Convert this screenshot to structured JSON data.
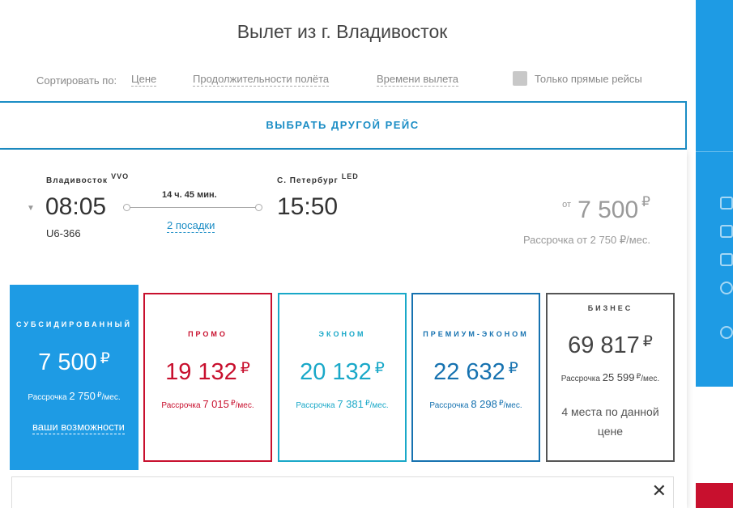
{
  "title": "Вылет из г. Владивосток",
  "sort": {
    "label": "Сортировать по:",
    "options": [
      "Цене",
      "Продолжительности полёта",
      "Времени вылета"
    ],
    "direct_only": "Только прямые рейсы",
    "direct_checked": false
  },
  "choose_other": "ВЫБРАТЬ ДРУГОЙ РЕЙС",
  "flight": {
    "from_city": "Владивосток",
    "from_code": "VVO",
    "to_city": "С. Петербург",
    "to_code": "LED",
    "depart_time": "08:05",
    "arrive_time": "15:50",
    "duration": "14 ч. 45 мин.",
    "stops": "2 посадки",
    "flight_number": "U6-366",
    "price_prefix": "от",
    "price": "7 500",
    "currency": "₽",
    "installment": "Рассрочка от 2 750 ₽/мес."
  },
  "fares": [
    {
      "name": "СУБСИДИРОВАННЫЙ",
      "price": "7 500",
      "inst_prefix": "Рассрочка",
      "inst_value": "2 750",
      "inst_suffix": "/мес.",
      "link": "ваши возможности"
    },
    {
      "name": "ПРОМО",
      "price": "19 132",
      "inst_prefix": "Рассрочка",
      "inst_value": "7 015",
      "inst_suffix": "/мес."
    },
    {
      "name": "ЭКОНОМ",
      "price": "20 132",
      "inst_prefix": "Рассрочка",
      "inst_value": "7 381",
      "inst_suffix": "/мес."
    },
    {
      "name": "ПРЕМИУМ-ЭКОНОМ",
      "price": "22 632",
      "inst_prefix": "Рассрочка",
      "inst_value": "8 298",
      "inst_suffix": "/мес."
    },
    {
      "name": "БИЗНЕС",
      "price": "69 817",
      "inst_prefix": "Рассрочка",
      "inst_value": "25 599",
      "inst_suffix": "/мес.",
      "note": "4 места по данной цене"
    }
  ],
  "currency": "₽",
  "close_symbol": "✕",
  "colors": {
    "accent": "#1b8dc5",
    "subsidized": "#1e9be4",
    "promo": "#c8102e",
    "economy": "#19a8c8",
    "premium": "#1672b0",
    "business": "#555555"
  }
}
